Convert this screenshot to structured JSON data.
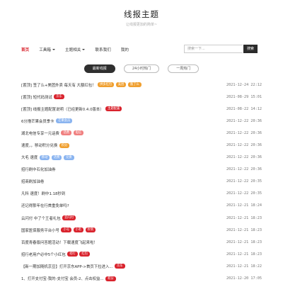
{
  "header": {
    "title": "线报主题",
    "subtitle": "让线报更加的简单~"
  },
  "nav": [
    {
      "label": "首页",
      "active": true,
      "dropdown": false
    },
    {
      "label": "工具箱",
      "active": false,
      "dropdown": true
    },
    {
      "label": "主题相关",
      "active": false,
      "dropdown": true
    },
    {
      "label": "联系我们",
      "active": false,
      "dropdown": false
    },
    {
      "label": "我的",
      "active": false,
      "dropdown": false
    }
  ],
  "search": {
    "placeholder": "搜索一下...",
    "button": "搜索"
  },
  "tabs": [
    {
      "label": "最新线报",
      "active": true
    },
    {
      "label": "24小时热门",
      "active": false
    },
    {
      "label": "一周热门",
      "active": false
    }
  ],
  "colors": {
    "accent": "#d9232d",
    "dark": "#2f2f2f",
    "orange": "#f0a030",
    "blue": "#8ab4f0",
    "pink": "#f08080",
    "red": "#d9232d"
  },
  "posts": [
    {
      "title": "[置顶] 签了么+美团外卖 每天有 大额红包！",
      "tags": [
        {
          "text": "拼多红包",
          "color": "#f0a030"
        },
        {
          "text": "美团",
          "color": "#f0a030"
        },
        {
          "text": "饿了么",
          "color": "#f0a030"
        }
      ],
      "time": "2021-12-24 22:12"
    },
    {
      "title": "[置顶] 短代码测试",
      "tags": [
        {
          "text": "京东",
          "color": "#d9232d"
        }
      ],
      "time": "2021-08-29 15:01"
    },
    {
      "title": "[置顶] 线报主题配置说明（已经更新0.4.0版本）",
      "tags": [
        {
          "text": "主题配置",
          "color": "#d9232d"
        }
      ],
      "time": "2021-08-22 14:12"
    },
    {
      "title": "6分撸芒果会员季卡",
      "tags": [
        {
          "text": "芒果会员",
          "color": "#8ab4f0"
        }
      ],
      "time": "2021-12-22 20:36"
    },
    {
      "title": "湖北电信专享一元话费",
      "tags": [
        {
          "text": "话费",
          "color": "#f08080"
        },
        {
          "text": "电信",
          "color": "#f08080"
        }
      ],
      "time": "2021-12-22 20:36"
    },
    {
      "title": "速度，，移动积分兑换",
      "tags": [
        {
          "text": "积分",
          "color": "#f0a030"
        }
      ],
      "time": "2021-12-22 20:36"
    },
    {
      "title": "大毛 速度",
      "tags": [
        {
          "text": "移动",
          "color": "#8ab4f0"
        },
        {
          "text": "话费",
          "color": "#8ab4f0"
        },
        {
          "text": "兑换",
          "color": "#8ab4f0"
        }
      ],
      "time": "2021-12-22 20:36"
    },
    {
      "title": "招行刷中石化加油券",
      "tags": [],
      "time": "2021-12-22 20:36"
    },
    {
      "title": "招商刷加油卷",
      "tags": [],
      "time": "2021-12-22 20:35"
    },
    {
      "title": "凡科 速度！刷中1.18秒到",
      "tags": [],
      "time": "2021-12-22 20:35"
    },
    {
      "title": "还记得那年在行首重免单吗?",
      "tags": [],
      "time": "2021-12-21 18:24"
    },
    {
      "title": "云闪付 中了个王者礼包",
      "tags": [
        {
          "text": "云闪付",
          "color": "#d9232d"
        }
      ],
      "time": "2021-12-21 18:23"
    },
    {
      "title": "国家医保服务平台小号",
      "tags": [
        {
          "text": "小号",
          "color": "#d9232d"
        },
        {
          "text": "小毛",
          "color": "#d9232d"
        },
        {
          "text": "秒到",
          "color": "#d9232d"
        }
      ],
      "time": "2021-12-21 18:23"
    },
    {
      "title": "百度青春版问答题活动！下载速度飞起来啦！",
      "tags": [],
      "time": "2021-12-21 18:23"
    },
    {
      "title": "招行老用户必中5个小红包",
      "tags": [
        {
          "text": "招行",
          "color": "#d9232d"
        },
        {
          "text": "红包",
          "color": "#d9232d"
        }
      ],
      "time": "2021-12-21 18:23"
    },
    {
      "title": "【新一期加随机京豆】打开京东APP->首页下拉进入...",
      "tags": [
        {
          "text": "京东",
          "color": "#d9232d"
        }
      ],
      "time": "2021-12-21 18:22"
    },
    {
      "title": "1、打开支付宝-我的-支付宝 会员-2、点击权益...",
      "tags": [
        {
          "text": "积分",
          "color": "#d9232d"
        }
      ],
      "time": "2021-12-20 17:05"
    }
  ]
}
